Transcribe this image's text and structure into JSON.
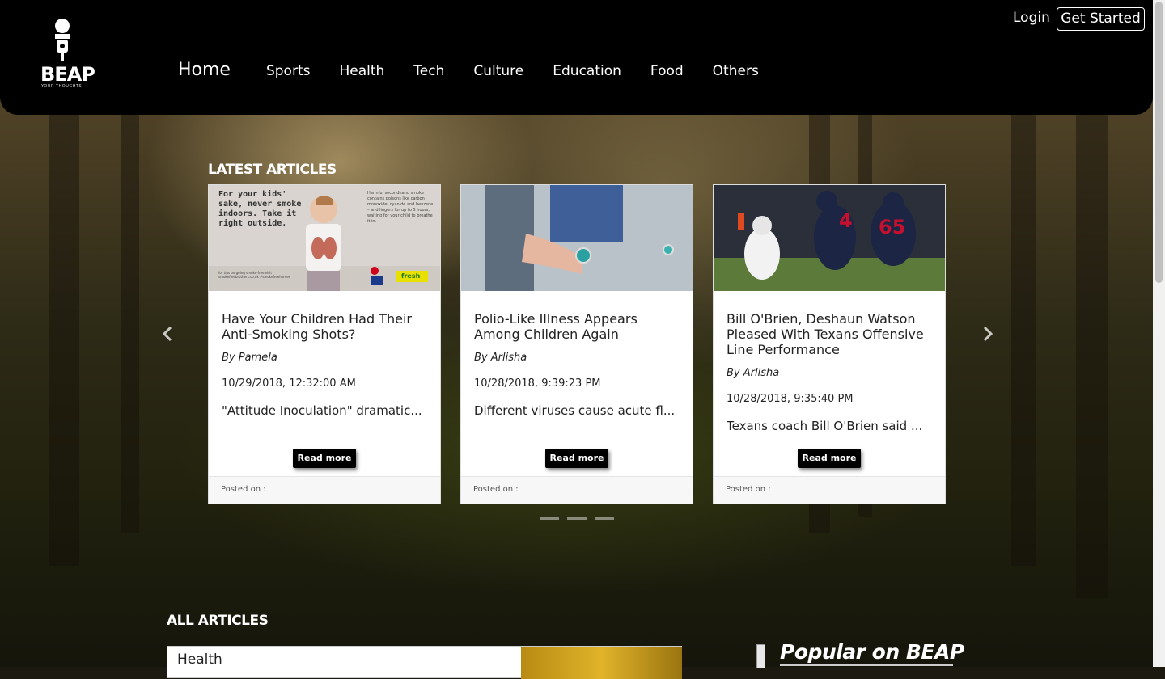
{
  "brand": {
    "name": "BEAP",
    "tagline": "YOUR THOUGHTS"
  },
  "nav": {
    "home": "Home",
    "items": [
      "Sports",
      "Health",
      "Tech",
      "Culture",
      "Education",
      "Food",
      "Others"
    ]
  },
  "auth": {
    "login": "Login",
    "get_started": "Get Started"
  },
  "latest": {
    "title": "LATEST ARTICLES",
    "cards": [
      {
        "title": "Have Your Children Had Their Anti-Smoking Shots?",
        "author": "By Pamela",
        "date": "10/29/2018, 12:32:00 AM",
        "excerpt": "\"Attitude Inoculation\" dramatic...",
        "read_more": "Read more",
        "footer": "Posted on :",
        "image_poster": {
          "headline": "For your kids' sake, never smoke indoors. Take it right outside.",
          "side_text": "Harmful secondhand smoke contains poisons like carbon monoxide, cyanide and benzene – and lingers for up to 5 hours, waiting for your child to breathe it in.",
          "footer_text": "for tips on going smoke-free visit smokefreebrothers.co.uk #smokefreehomes",
          "logo_text": "fresh"
        }
      },
      {
        "title": "Polio-Like Illness Appears Among Children Again",
        "author": "By Arlisha",
        "date": "10/28/2018, 9:39:23 PM",
        "excerpt": "Different viruses cause acute fl...",
        "read_more": "Read more",
        "footer": "Posted on :"
      },
      {
        "title": "Bill O'Brien, Deshaun Watson Pleased With Texans Offensive Line Performance",
        "author": "By Arlisha",
        "date": "10/28/2018, 9:35:40 PM",
        "excerpt": "Texans coach Bill O'Brien said ...",
        "read_more": "Read more",
        "footer": "Posted on :",
        "image_numbers": [
          "4",
          "65"
        ]
      }
    ]
  },
  "all_articles": {
    "title": "ALL ARTICLES",
    "first_label": "Health"
  },
  "popular": {
    "title": "Popular on BEAP"
  },
  "colors": {
    "topbar": "#000000",
    "card": "#ffffff",
    "button": "#000000",
    "jersey": "#1c2644",
    "jersey_accent": "#c8102e"
  }
}
